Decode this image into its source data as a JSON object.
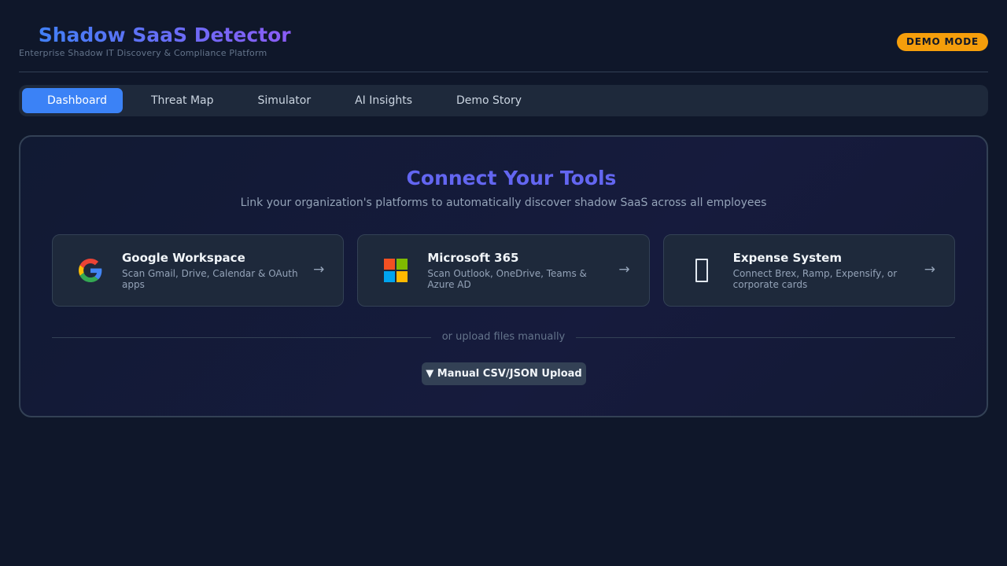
{
  "header": {
    "title": "Shadow SaaS Detector",
    "title_icon": "shield-icon",
    "subtitle": "Enterprise Shadow IT Discovery & Compliance Platform",
    "badge": "DEMO MODE"
  },
  "tabs": [
    {
      "label": "Dashboard",
      "icon": "chart-icon",
      "active": true
    },
    {
      "label": "Threat Map",
      "icon": "map-icon",
      "active": false
    },
    {
      "label": "Simulator",
      "icon": "flask-icon",
      "active": false
    },
    {
      "label": "AI Insights",
      "icon": "sparkle-icon",
      "active": false
    },
    {
      "label": "Demo Story",
      "icon": "book-icon",
      "active": false
    }
  ],
  "connect": {
    "title": "Connect Your Tools",
    "title_icon": "link-icon",
    "subtitle": "Link your organization's platforms to automatically discover shadow SaaS across all employees",
    "cards": [
      {
        "title": "Google Workspace",
        "desc": "Scan Gmail, Drive, Calendar & OAuth apps",
        "icon": "google-icon",
        "arrow": "→"
      },
      {
        "title": "Microsoft 365",
        "desc": "Scan Outlook, OneDrive, Teams & Azure AD",
        "icon": "microsoft-icon",
        "arrow": "→"
      },
      {
        "title": "Expense System",
        "desc": "Connect Brex, Ramp, Expensify, or corporate cards",
        "icon": "receipt-icon",
        "arrow": "→"
      }
    ],
    "divider_text": "or upload files manually",
    "upload_button": "▼ Manual CSV/JSON Upload"
  },
  "colors": {
    "background": "#0f172a",
    "accent": "#3b82f6",
    "title_gradient_end": "#8b5cf6",
    "connect_title": "#6366f1",
    "badge": "#f59e0b"
  }
}
